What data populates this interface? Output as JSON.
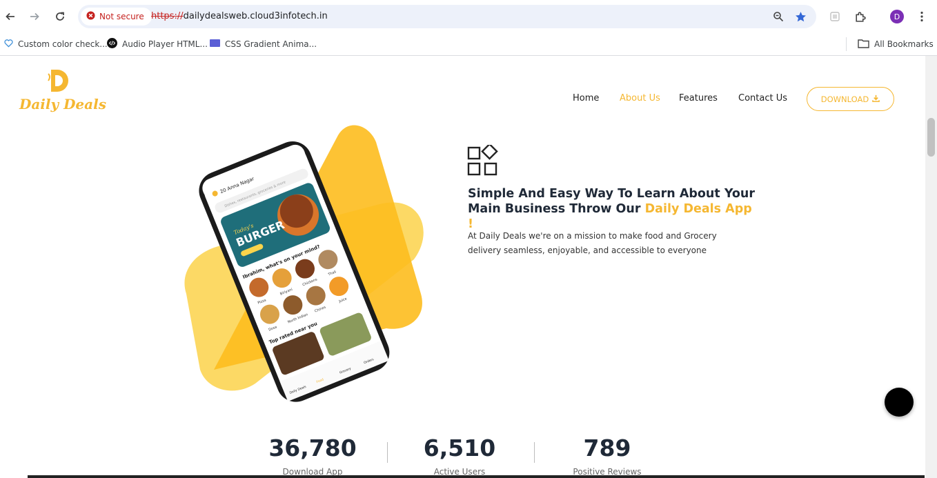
{
  "browser": {
    "security_label": "Not secure",
    "url_scheme": "https://",
    "url_host": "dailydealsweb.cloud3infotech.in",
    "profile_initial": "D",
    "bookmarks": [
      {
        "label": "Custom color check...",
        "icon": "heart-icon"
      },
      {
        "label": "Audio Player HTML...",
        "icon": "code-icon"
      },
      {
        "label": "CSS Gradient Anima...",
        "icon": "gradient-icon"
      }
    ],
    "all_bookmarks_label": "All Bookmarks"
  },
  "site": {
    "logo_text": "Daily Deals",
    "brand_color": "#f5b731",
    "nav": {
      "home": "Home",
      "about": "About Us",
      "features": "Features",
      "contact": "Contact Us",
      "active": "about"
    },
    "download_label": "DOWNLOAD",
    "hero": {
      "headline_prefix": "Simple And Easy Way To Learn About Your Main Business Throw Our",
      "headline_accent": "Daily Deals App !",
      "description": "At Daily Deals we're on a mission to make food and Grocery delivery seamless, enjoyable, and accessible to everyone"
    },
    "phone": {
      "location": "20 Anna Nagar",
      "search_placeholder": "Dishes, restaurants, groceries & more",
      "banner_script": "Today's",
      "banner_title": "BURGER",
      "section_title": "Ibrahim, what's on your mind?",
      "categories": [
        "Pizza",
        "Biriyani",
        "Chickens",
        "Thali",
        "Dosa",
        "North Indian",
        "Chines",
        "Juice"
      ],
      "top_rated": "Top rated near you",
      "tabs": [
        "Daily Deals",
        "Food",
        "Grocery",
        "Orders"
      ]
    },
    "stats": [
      {
        "value": "36,780",
        "label": "Download App"
      },
      {
        "value": "6,510",
        "label": "Active Users"
      },
      {
        "value": "789",
        "label": "Positive Reviews"
      }
    ]
  }
}
